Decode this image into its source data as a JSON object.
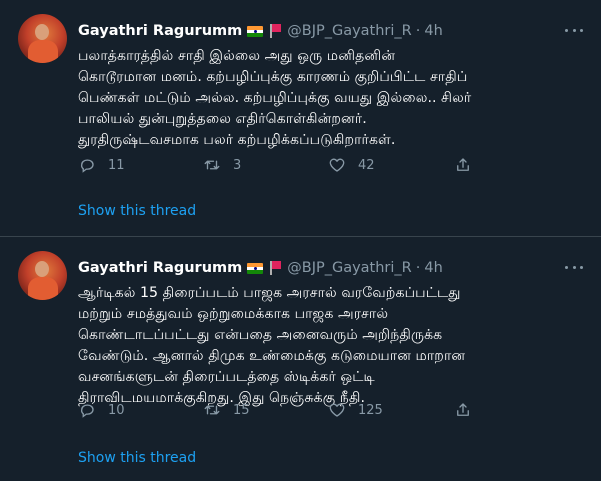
{
  "tweets": [
    {
      "name": "Gayathri Ragurumm",
      "handle": "@BJP_Gayathri_R",
      "separator": "·",
      "time": "4h",
      "lines": [
        "பலாத்காரத்தில் சாதி இல்லை அது ஒரு மனிதனின்",
        "கொடூரமான மனம். கற்பழிப்புக்கு காரணம் குறிப்பிட்ட சாதிப்",
        "பெண்கள் மட்டும் அல்ல. கற்பழிப்புக்கு வயது இல்லை.. சிலர்",
        "பாலியல் துன்புறுத்தலை எதிர்கொள்கின்றனர்.",
        "துரதிருஷ்டவசமாக பலர் கற்பழிக்கப்படுகிறார்கள்."
      ],
      "replies": "11",
      "retweets": "3",
      "likes": "42",
      "show_thread": "Show this thread"
    },
    {
      "name": "Gayathri Ragurumm",
      "handle": "@BJP_Gayathri_R",
      "separator": "·",
      "time": "4h",
      "lines": [
        "ஆர்டிகல் 15 திரைப்படம் பாஜக அரசால் வரவேற்கப்பட்டது",
        "மற்றும் சமத்துவம் ஒற்றுமைக்காக பாஜக அரசால்",
        "கொண்டாடப்பட்டது என்பதை அனைவரும் அறிந்திருக்க",
        "வேண்டும். ஆனால் திமுக உண்மைக்கு கடுமையான மாறான",
        "வசனங்களுடன் திரைப்படத்தை ஸ்டிக்கர் ஒட்டி",
        "திராவிடமயமாக்குகிறது. இது நெஞ்சுக்கு நீதி."
      ],
      "replies": "10",
      "retweets": "15",
      "likes": "125",
      "show_thread": "Show this thread"
    }
  ],
  "icons": {
    "reply": "reply-icon",
    "retweet": "retweet-icon",
    "like": "heart-icon",
    "share": "share-icon",
    "more": "more-icon",
    "flag1": "india-flag-icon",
    "flag2": "red-flag-icon"
  },
  "colors": {
    "background": "#15202b",
    "divider": "#38444d",
    "secondary_text": "#8899a6",
    "link": "#1da1f2"
  }
}
